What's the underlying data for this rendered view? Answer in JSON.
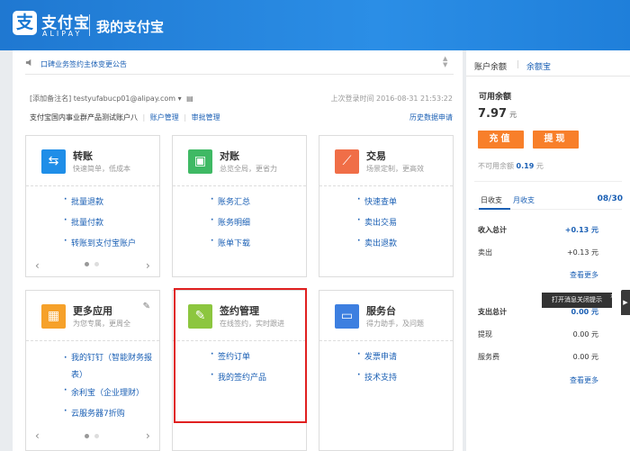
{
  "header": {
    "logo_glyph": "支",
    "logo_cn": "支付宝",
    "logo_en": "ALIPAY",
    "title": "我的支付宝"
  },
  "notice": {
    "text": "口碑业务签约主体变更公告",
    "icon": "speaker-icon"
  },
  "account": {
    "email_label": "[添加备注名]",
    "email": "testyufabucp01@alipay.com",
    "last_login": "上次登录时间 2016-08-31 21:53:22",
    "org_text": "支付宝国内事业群产品测试账户八",
    "manage_label": "账户管理",
    "audit_label": "审批管理",
    "history_label": "历史数据申请"
  },
  "cards": [
    {
      "title": "转账",
      "subtitle": "快速简单，低成本",
      "icon": "transfer-icon",
      "color": "#1f8ee8",
      "links": [
        "批量退款",
        "批量付款",
        "转账到支付宝账户"
      ]
    },
    {
      "title": "对账",
      "subtitle": "总览全局，更省力",
      "icon": "reconcile-icon",
      "color": "#3fb964",
      "links": [
        "账务汇总",
        "账务明细",
        "账单下载"
      ]
    },
    {
      "title": "交易",
      "subtitle": "场景定制，更高效",
      "icon": "trade-icon",
      "color": "#f06e47",
      "links": [
        "快速查单",
        "卖出交易",
        "卖出退款"
      ]
    },
    {
      "title": "更多应用",
      "subtitle": "为您专属，更周全",
      "icon": "apps-icon",
      "color": "#f6a12a",
      "links": [
        "我的钉钉（智能财务报表）",
        "余利宝（企业理财）",
        "云服务器7折购"
      ]
    },
    {
      "title": "签约管理",
      "subtitle": "在线签约，实时跟进",
      "icon": "sign-icon",
      "color": "#8cc63f",
      "links": [
        "签约订单",
        "我的签约产品"
      ]
    },
    {
      "title": "服务台",
      "subtitle": "得力助手，及问题",
      "icon": "service-icon",
      "color": "#3d7fe0",
      "links": [
        "发票申请",
        "技术支持"
      ]
    }
  ],
  "sidebar": {
    "tab_balance": "账户余额",
    "tab_yuebao": "余额宝",
    "available_label": "可用余额",
    "balance": "7.97",
    "balance_unit": "元",
    "recharge_label": "充值",
    "withdraw_label": "提现",
    "unavailable_label": "不可用余额",
    "unavailable_value": "0.19",
    "unavailable_unit": "元",
    "day_tab": "日收支",
    "month_tab": "月收支",
    "date": "08/30",
    "income_total_label": "收入总计",
    "income_total_value": "+0.13 元",
    "sold_label": "卖出",
    "sold_value": "+0.13 元",
    "more_label": "查看更多",
    "expense_total_label": "支出总计",
    "expense_total_value": "0.00 元",
    "withdraw_row_label": "提现",
    "withdraw_row_value": "0.00 元",
    "fee_label": "服务费",
    "fee_value": "0.00 元",
    "more_label2": "查看更多"
  },
  "tooltip": {
    "text": "打开消息关闭提示",
    "close": "×"
  }
}
